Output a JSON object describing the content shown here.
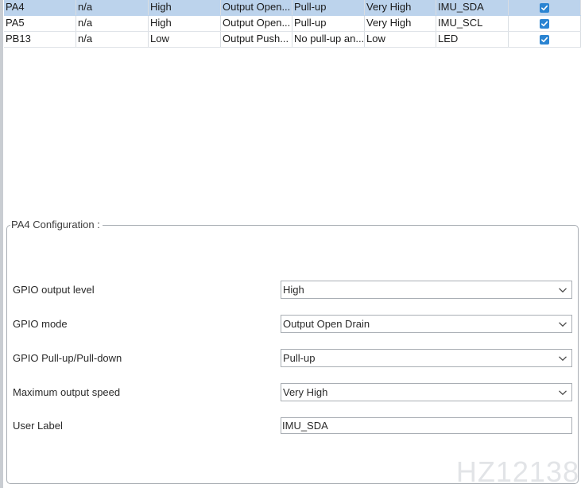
{
  "gpio_table": {
    "rows": [
      {
        "pin": "PA4",
        "signal": "n/a",
        "output_level": "High",
        "mode": "Output Open...",
        "pull": "Pull-up",
        "speed": "Very High",
        "label": "IMU_SDA",
        "modified": true,
        "selected": true
      },
      {
        "pin": "PA5",
        "signal": "n/a",
        "output_level": "High",
        "mode": "Output Open...",
        "pull": "Pull-up",
        "speed": "Very High",
        "label": "IMU_SCL",
        "modified": true,
        "selected": false
      },
      {
        "pin": "PB13",
        "signal": "n/a",
        "output_level": "Low",
        "mode": "Output Push...",
        "pull": "No pull-up an...",
        "speed": "Low",
        "label": "LED",
        "modified": true,
        "selected": false
      }
    ]
  },
  "config": {
    "title": "PA4 Configuration :",
    "output_level": {
      "label": "GPIO output level",
      "value": "High"
    },
    "mode": {
      "label": "GPIO mode",
      "value": "Output Open Drain"
    },
    "pull": {
      "label": "GPIO Pull-up/Pull-down",
      "value": "Pull-up"
    },
    "speed": {
      "label": "Maximum output speed",
      "value": "Very High"
    },
    "user_label": {
      "label": "User Label",
      "value": "IMU_SDA"
    }
  },
  "watermark": "HZ12138",
  "colors": {
    "selected_row": "#bcd3ec",
    "checkbox": "#2a84d2",
    "border": "#a8adb3"
  },
  "icons": {
    "checkbox": "checkbox-checked-icon",
    "dropdown": "chevron-down-icon"
  }
}
